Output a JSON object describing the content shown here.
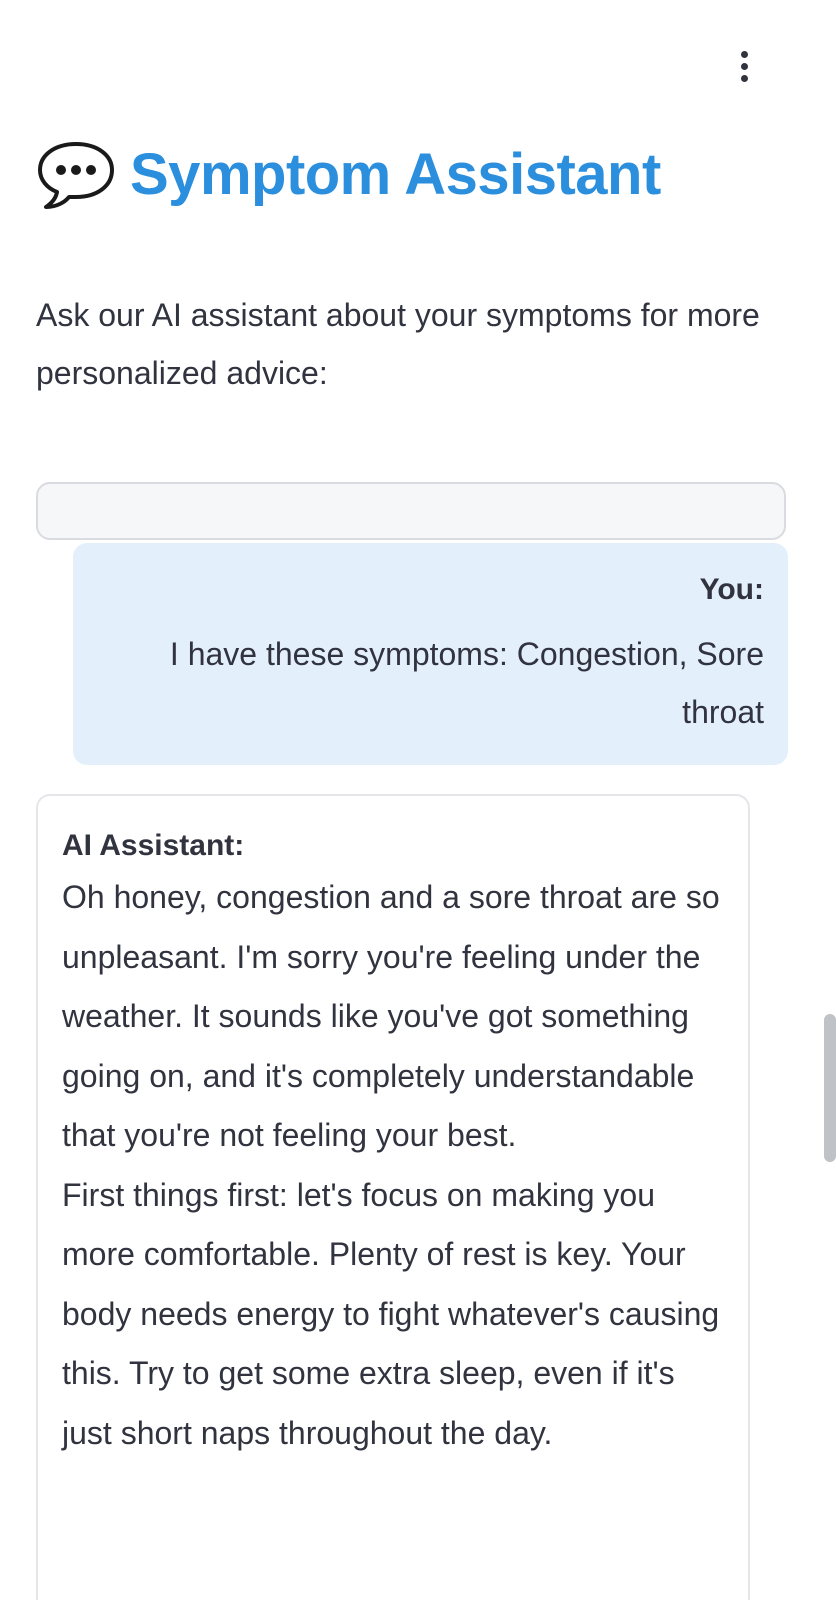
{
  "header": {
    "menu_icon": "kebab-menu-icon",
    "title_icon": "speech-balloon-icon",
    "title": "Symptom Assistant"
  },
  "intro": {
    "text": "Ask our AI assistant about your symptoms for more personalized advice:"
  },
  "chat_input": {
    "value": "",
    "placeholder": ""
  },
  "messages": {
    "user": {
      "sender": "You:",
      "text": "I have these symptoms: Congestion, Sore throat"
    },
    "assistant": {
      "sender": "AI Assistant:",
      "paragraphs": [
        "Oh honey, congestion and a sore throat are so unpleasant. I'm sorry you're feeling under the weather. It sounds like you've got something going on, and it's completely understandable that you're not feeling your best.",
        "First things first: let's focus on making you more comfortable. Plenty of rest is key. Your body needs energy to fight whatever's causing this. Try to get some extra sleep, even if it's just short naps throughout the day."
      ]
    }
  },
  "colors": {
    "title": "#2b8fde",
    "user_bubble": "#e3f0fc",
    "text": "#31333f",
    "border": "#e4e6ea"
  }
}
